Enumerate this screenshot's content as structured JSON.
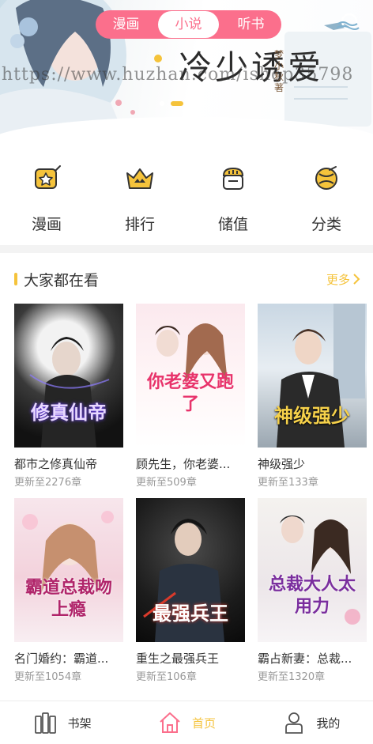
{
  "banner": {
    "tabs": [
      {
        "label": "漫画",
        "active": false
      },
      {
        "label": "小说",
        "active": true
      },
      {
        "label": "听书",
        "active": false
      }
    ],
    "title": "冷少诱爱",
    "author": "梦小秋著",
    "watermark": "https://www.huzhan.com/ishop35798",
    "slide_count": 3,
    "active_slide": 2,
    "search_icon": "search-icon",
    "colors": {
      "tab_bg": "#fb6f8c",
      "accent": "#f5c33b"
    }
  },
  "nav": [
    {
      "label": "漫画",
      "icon": "comic-icon"
    },
    {
      "label": "排行",
      "icon": "crown-icon"
    },
    {
      "label": "储值",
      "icon": "recharge-icon"
    },
    {
      "label": "分类",
      "icon": "category-icon"
    }
  ],
  "section": {
    "title": "大家都在看",
    "more": "更多"
  },
  "books": [
    {
      "name": "都市之修真仙帝",
      "chapters": "更新至2276章",
      "cover_text": "修真仙帝"
    },
    {
      "name": "顾先生，你老婆...",
      "chapters": "更新至509章",
      "cover_text": "你老婆又跑了"
    },
    {
      "name": "神级强少",
      "chapters": "更新至133章",
      "cover_text": "神级强少"
    },
    {
      "name": "名门婚约：霸道...",
      "chapters": "更新至1054章",
      "cover_text": "霸道总裁吻上瘾"
    },
    {
      "name": "重生之最强兵王",
      "chapters": "更新至106章",
      "cover_text": "最强兵王"
    },
    {
      "name": "霸占新妻：总裁...",
      "chapters": "更新至1320章",
      "cover_text": "总裁大人太用力"
    }
  ],
  "tabbar": [
    {
      "label": "书架",
      "icon": "bookshelf-icon",
      "active": false
    },
    {
      "label": "首页",
      "icon": "home-icon",
      "active": true
    },
    {
      "label": "我的",
      "icon": "profile-icon",
      "active": false
    }
  ]
}
